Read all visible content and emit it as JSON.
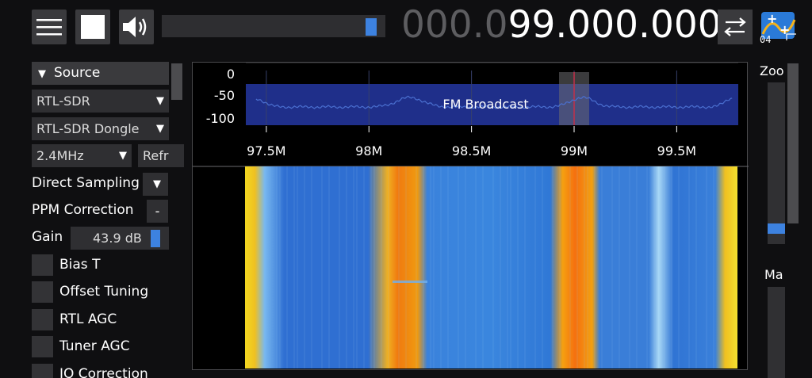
{
  "toolbar": {
    "volume_level": 0.96
  },
  "frequency": {
    "leading_dim": "000.0",
    "main": "99.000.000"
  },
  "tuning_icon_label": "04",
  "source_panel": {
    "header": "Source",
    "source_type": "RTL-SDR",
    "device": "RTL-SDR Dongle",
    "sample_rate": "2.4MHz",
    "refresh_label": "Refr",
    "direct_sampling_label": "Direct Sampling",
    "ppm_label": "PPM Correction",
    "ppm_value": "-",
    "gain_label": "Gain",
    "gain_value": "43.9 dB",
    "gain_level": 0.9,
    "checkboxes": [
      {
        "label": "Bias T",
        "checked": false
      },
      {
        "label": "Offset Tuning",
        "checked": false
      },
      {
        "label": "RTL AGC",
        "checked": false
      },
      {
        "label": "Tuner AGC",
        "checked": false
      },
      {
        "label": "IQ Correction",
        "checked": false
      }
    ]
  },
  "spectrum": {
    "db_ticks": [
      "0",
      "-50",
      "-100"
    ],
    "freq_ticks": [
      {
        "label": "97.5M",
        "mhz": 97.5
      },
      {
        "label": "98M",
        "mhz": 98.0
      },
      {
        "label": "98.5M",
        "mhz": 98.5
      },
      {
        "label": "99M",
        "mhz": 99.0
      },
      {
        "label": "99.5M",
        "mhz": 99.5
      }
    ],
    "span_mhz": [
      97.4,
      99.8
    ],
    "tuned_mhz": 99.0,
    "band_label": "FM Broadcast",
    "colors": {
      "band": "#1f2f8a",
      "trace": "#4a6fd0",
      "tuner_line": "#c2304a",
      "tuner_shade": "#6b6b70"
    }
  },
  "right_panel": {
    "zoom_label": "Zoo",
    "max_label": "Ma",
    "zoom_level": 0.07
  },
  "colors": {
    "accent": "#3d82e0",
    "button_bg": "#3a3a3d"
  }
}
